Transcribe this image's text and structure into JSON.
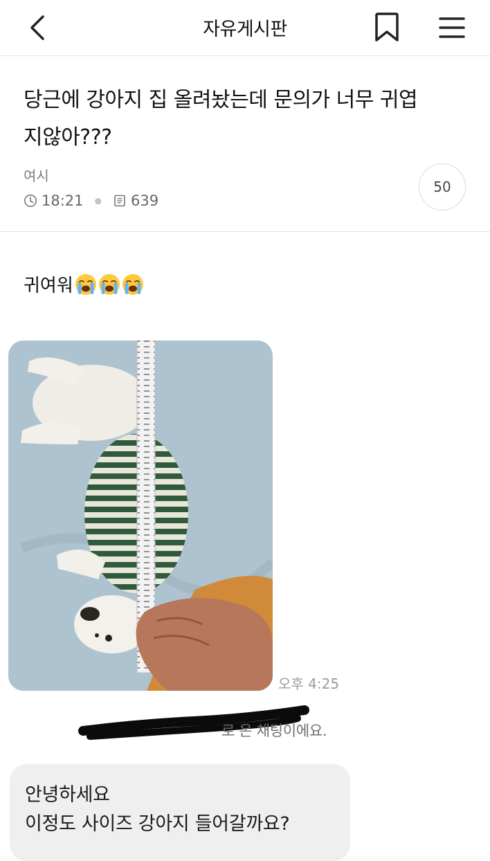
{
  "header": {
    "board_title": "자유게시판",
    "icons": [
      "back-icon",
      "bookmark-icon",
      "menu-icon"
    ]
  },
  "post": {
    "title_line1": "당근에 강아지 집 올려놨는데 문의가 너무 귀엽",
    "title_line2": "지않아???",
    "author": "여시",
    "time": "18:21",
    "views": "639",
    "comment_count": "50",
    "body_text": "귀여워",
    "body_emojis": [
      "loudly-crying-face",
      "loudly-crying-face",
      "loudly-crying-face"
    ]
  },
  "chat": {
    "photo_time": "오후 4:25",
    "notice": "로 온 채팅이에요.",
    "message_line1": "안녕하세요",
    "message_line2": "이정도 사이즈 강아지 들어갈까요?"
  },
  "colors": {
    "divider": "#e3e3e3",
    "meta_text": "#666666",
    "bubble_bg": "#efefef",
    "photo_bg": "#a9bfcc",
    "stripe_green": "#2f5a3c"
  }
}
